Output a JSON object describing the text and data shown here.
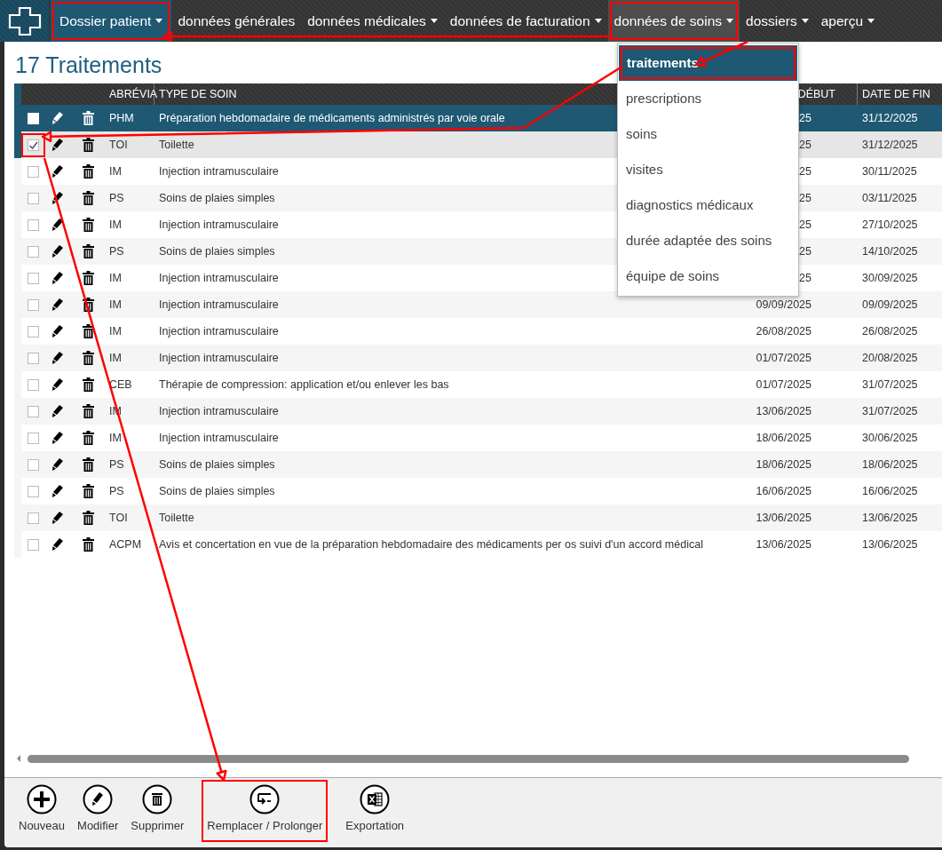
{
  "nav": {
    "items": [
      {
        "label": "Dossier patient",
        "caret": true,
        "selected": true,
        "highlighted": true
      },
      {
        "label": "données générales",
        "caret": false,
        "selected": false,
        "highlighted": false
      },
      {
        "label": "données médicales",
        "caret": true,
        "selected": false,
        "highlighted": false
      },
      {
        "label": "données de facturation",
        "caret": true,
        "selected": false,
        "highlighted": false
      },
      {
        "label": "données de soins",
        "caret": true,
        "selected": true,
        "highlighted": true
      },
      {
        "label": "dossiers",
        "caret": true,
        "selected": false,
        "highlighted": false
      },
      {
        "label": "aperçu",
        "caret": true,
        "selected": false,
        "highlighted": false
      }
    ]
  },
  "menu": {
    "items": [
      {
        "label": "traitements",
        "selected": true,
        "highlighted": true
      },
      {
        "label": "prescriptions",
        "selected": false,
        "highlighted": false
      },
      {
        "label": "soins",
        "selected": false,
        "highlighted": false
      },
      {
        "label": "visites",
        "selected": false,
        "highlighted": false
      },
      {
        "label": "diagnostics médicaux",
        "selected": false,
        "highlighted": false
      },
      {
        "label": "durée adaptée des soins",
        "selected": false,
        "highlighted": false
      },
      {
        "label": "équipe de soins",
        "selected": false,
        "highlighted": false
      }
    ]
  },
  "title": "17 Traitements",
  "table": {
    "columns": [
      "ABRÉVIA",
      "TYPE DE SOIN",
      "DÉBUT",
      "DATE DE FIN"
    ],
    "rows": [
      {
        "abbr": "PHM",
        "type": "Préparation hebdomadaire de médicaments administrés par voie orale",
        "start": "25",
        "end": "31/12/2025",
        "selected": true,
        "checked": false,
        "highlighted": false
      },
      {
        "abbr": "TOI",
        "type": "Toilette",
        "start": "25",
        "end": "31/12/2025",
        "selected": false,
        "checked": true,
        "highlighted": true
      },
      {
        "abbr": "IM",
        "type": "Injection intramusculaire",
        "start": "25",
        "end": "30/11/2025",
        "selected": false,
        "checked": false,
        "highlighted": false
      },
      {
        "abbr": "PS",
        "type": "Soins de plaies simples",
        "start": "25",
        "end": "03/11/2025",
        "selected": false,
        "checked": false,
        "highlighted": false
      },
      {
        "abbr": "IM",
        "type": "Injection intramusculaire",
        "start": "25",
        "end": "27/10/2025",
        "selected": false,
        "checked": false,
        "highlighted": false
      },
      {
        "abbr": "PS",
        "type": "Soins de plaies simples",
        "start": "25",
        "end": "14/10/2025",
        "selected": false,
        "checked": false,
        "highlighted": false
      },
      {
        "abbr": "IM",
        "type": "Injection intramusculaire",
        "start": "25",
        "end": "30/09/2025",
        "selected": false,
        "checked": false,
        "highlighted": false
      },
      {
        "abbr": "IM",
        "type": "Injection intramusculaire",
        "start": "09/09/2025",
        "end": "09/09/2025",
        "selected": false,
        "checked": false,
        "highlighted": false
      },
      {
        "abbr": "IM",
        "type": "Injection intramusculaire",
        "start": "26/08/2025",
        "end": "26/08/2025",
        "selected": false,
        "checked": false,
        "highlighted": false
      },
      {
        "abbr": "IM",
        "type": "Injection intramusculaire",
        "start": "01/07/2025",
        "end": "20/08/2025",
        "selected": false,
        "checked": false,
        "highlighted": false
      },
      {
        "abbr": "CEB",
        "type": "Thérapie de compression: application et/ou enlever les bas",
        "start": "01/07/2025",
        "end": "31/07/2025",
        "selected": false,
        "checked": false,
        "highlighted": false
      },
      {
        "abbr": "IM",
        "type": "Injection intramusculaire",
        "start": "13/06/2025",
        "end": "31/07/2025",
        "selected": false,
        "checked": false,
        "highlighted": false
      },
      {
        "abbr": "IM",
        "type": "Injection intramusculaire",
        "start": "18/06/2025",
        "end": "30/06/2025",
        "selected": false,
        "checked": false,
        "highlighted": false
      },
      {
        "abbr": "PS",
        "type": "Soins de plaies simples",
        "start": "18/06/2025",
        "end": "18/06/2025",
        "selected": false,
        "checked": false,
        "highlighted": false
      },
      {
        "abbr": "PS",
        "type": "Soins de plaies simples",
        "start": "16/06/2025",
        "end": "16/06/2025",
        "selected": false,
        "checked": false,
        "highlighted": false
      },
      {
        "abbr": "TOI",
        "type": "Toilette",
        "start": "13/06/2025",
        "end": "13/06/2025",
        "selected": false,
        "checked": false,
        "highlighted": false
      },
      {
        "abbr": "ACPM",
        "type": "Avis et concertation en vue de la préparation hebdomadaire des médicaments per os suivi d'un accord médical",
        "start": "13/06/2025",
        "end": "13/06/2025",
        "selected": false,
        "checked": false,
        "highlighted": false
      }
    ]
  },
  "toolbar": {
    "buttons": [
      {
        "label": "Nouveau",
        "kind": "plus",
        "highlighted": false
      },
      {
        "label": "Modifier",
        "kind": "pencil",
        "highlighted": false
      },
      {
        "label": "Supprimer",
        "kind": "trash",
        "highlighted": false
      },
      {
        "label": "Remplacer / Prolonger",
        "kind": "replace",
        "highlighted": true
      },
      {
        "label": "Exportation",
        "kind": "excel",
        "highlighted": false
      }
    ]
  }
}
